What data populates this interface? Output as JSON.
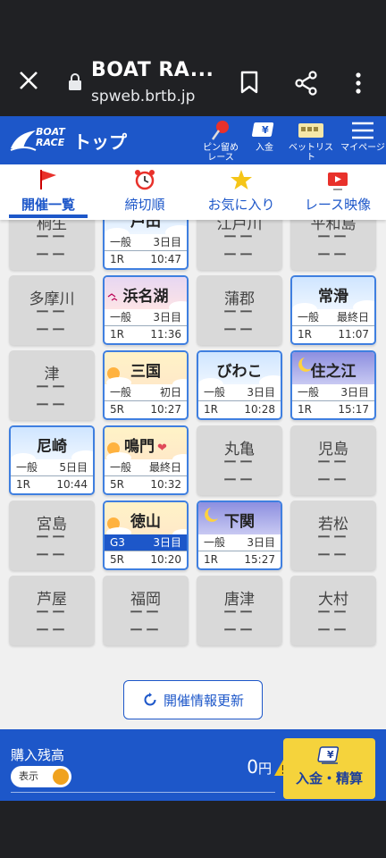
{
  "browser": {
    "title": "BOAT RA...",
    "url": "spweb.brtb.jp"
  },
  "header": {
    "logo_line1": "BOAT",
    "logo_line2": "RACE",
    "page_title": "トップ",
    "buttons": [
      {
        "label": "ピン留め\nレース",
        "icon": "pin-icon"
      },
      {
        "label": "入金",
        "icon": "deposit-icon"
      },
      {
        "label": "ベットリスト",
        "icon": "bet-list-icon"
      },
      {
        "label": "マイページ",
        "icon": "menu-icon"
      }
    ]
  },
  "tabs": [
    {
      "label": "開催一覧",
      "icon": "flag-icon",
      "active": true
    },
    {
      "label": "締切順",
      "icon": "alarm-clock-icon",
      "active": false
    },
    {
      "label": "お気に入り",
      "icon": "star-icon",
      "active": false
    },
    {
      "label": "レース映像",
      "icon": "video-icon",
      "active": false
    }
  ],
  "venues": [
    {
      "name": "桐生",
      "open": false
    },
    {
      "name": "戸田",
      "open": true,
      "theme": "day",
      "grade": "一般",
      "day": "3日目",
      "race": "1R",
      "time": "10:47"
    },
    {
      "name": "江戸川",
      "open": false
    },
    {
      "name": "平和島",
      "open": false
    },
    {
      "name": "多摩川",
      "open": false
    },
    {
      "name": "浜名湖",
      "open": true,
      "theme": "pink",
      "grade": "一般",
      "day": "3日目",
      "race": "1R",
      "time": "11:36"
    },
    {
      "name": "蒲郡",
      "open": false
    },
    {
      "name": "常滑",
      "open": true,
      "theme": "day",
      "grade": "一般",
      "day": "最終日",
      "race": "1R",
      "time": "11:07"
    },
    {
      "name": "津",
      "open": false
    },
    {
      "name": "三国",
      "open": true,
      "theme": "eve",
      "grade": "一般",
      "day": "初日",
      "race": "5R",
      "time": "10:27"
    },
    {
      "name": "びわこ",
      "open": true,
      "theme": "day",
      "grade": "一般",
      "day": "3日目",
      "race": "1R",
      "time": "10:28"
    },
    {
      "name": "住之江",
      "open": true,
      "theme": "night",
      "grade": "一般",
      "day": "3日目",
      "race": "1R",
      "time": "15:17"
    },
    {
      "name": "尼崎",
      "open": true,
      "theme": "day",
      "grade": "一般",
      "day": "5日目",
      "race": "1R",
      "time": "10:44"
    },
    {
      "name": "鳴門",
      "open": true,
      "theme": "eve",
      "fav": true,
      "grade": "一般",
      "day": "最終日",
      "race": "5R",
      "time": "10:32"
    },
    {
      "name": "丸亀",
      "open": false
    },
    {
      "name": "児島",
      "open": false
    },
    {
      "name": "宮島",
      "open": false
    },
    {
      "name": "徳山",
      "open": true,
      "theme": "eve",
      "g3": true,
      "grade": "G3",
      "day": "3日目",
      "race": "5R",
      "time": "10:20"
    },
    {
      "name": "下関",
      "open": true,
      "theme": "night",
      "grade": "一般",
      "day": "3日目",
      "race": "1R",
      "time": "15:27"
    },
    {
      "name": "若松",
      "open": false
    },
    {
      "name": "芦屋",
      "open": false
    },
    {
      "name": "福岡",
      "open": false
    },
    {
      "name": "唐津",
      "open": false
    },
    {
      "name": "大村",
      "open": false
    }
  ],
  "closed_mark": "ーー",
  "refresh_label": "開催情報更新",
  "footer": {
    "balance_label": "購入残高",
    "toggle_label": "表示",
    "amount": "0",
    "unit": "円",
    "deposit_button": "入金・精算"
  },
  "colors": {
    "brand_blue": "#1d57c9",
    "deposit_yellow": "#f5d33c",
    "closed_gray": "#d9d9d9"
  }
}
